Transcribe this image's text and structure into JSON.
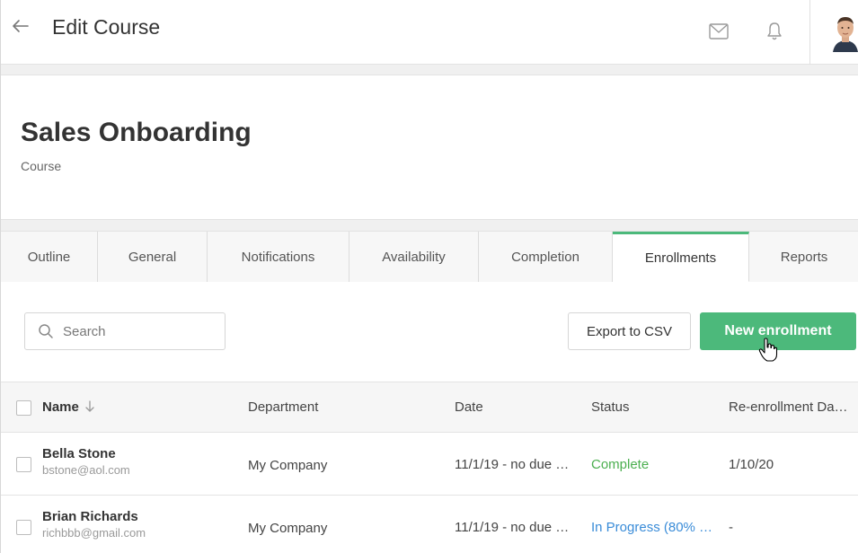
{
  "header": {
    "title": "Edit Course",
    "icons": [
      "back-arrow-icon",
      "mail-icon",
      "bell-icon",
      "avatar"
    ]
  },
  "course": {
    "title": "Sales Onboarding",
    "type": "Course"
  },
  "tabs": [
    {
      "label": "Outline",
      "active": false
    },
    {
      "label": "General",
      "active": false
    },
    {
      "label": "Notifications",
      "active": false
    },
    {
      "label": "Availability",
      "active": false
    },
    {
      "label": "Completion",
      "active": false
    },
    {
      "label": "Enrollments",
      "active": true
    },
    {
      "label": "Reports",
      "active": false
    }
  ],
  "toolbar": {
    "search_placeholder": "Search",
    "export_label": "Export to CSV",
    "new_enrollment_label": "New enrollment"
  },
  "table": {
    "columns": [
      "Name",
      "Department",
      "Date",
      "Status",
      "Re-enrollment Da…"
    ],
    "rows": [
      {
        "name": "Bella Stone",
        "email": "bstone@aol.com",
        "department": "My Company",
        "date": "11/1/19 - no due …",
        "status": "Complete",
        "reenroll": "1/10/20"
      },
      {
        "name": "Brian Richards",
        "email": "richbbb@gmail.com",
        "department": "My Company",
        "date": "11/1/19 - no due …",
        "status": "In Progress (80% …",
        "reenroll": "-"
      }
    ]
  },
  "colors": {
    "accent": "#4cb97b",
    "complete": "#4caf50",
    "in_progress": "#3a8cd8"
  }
}
